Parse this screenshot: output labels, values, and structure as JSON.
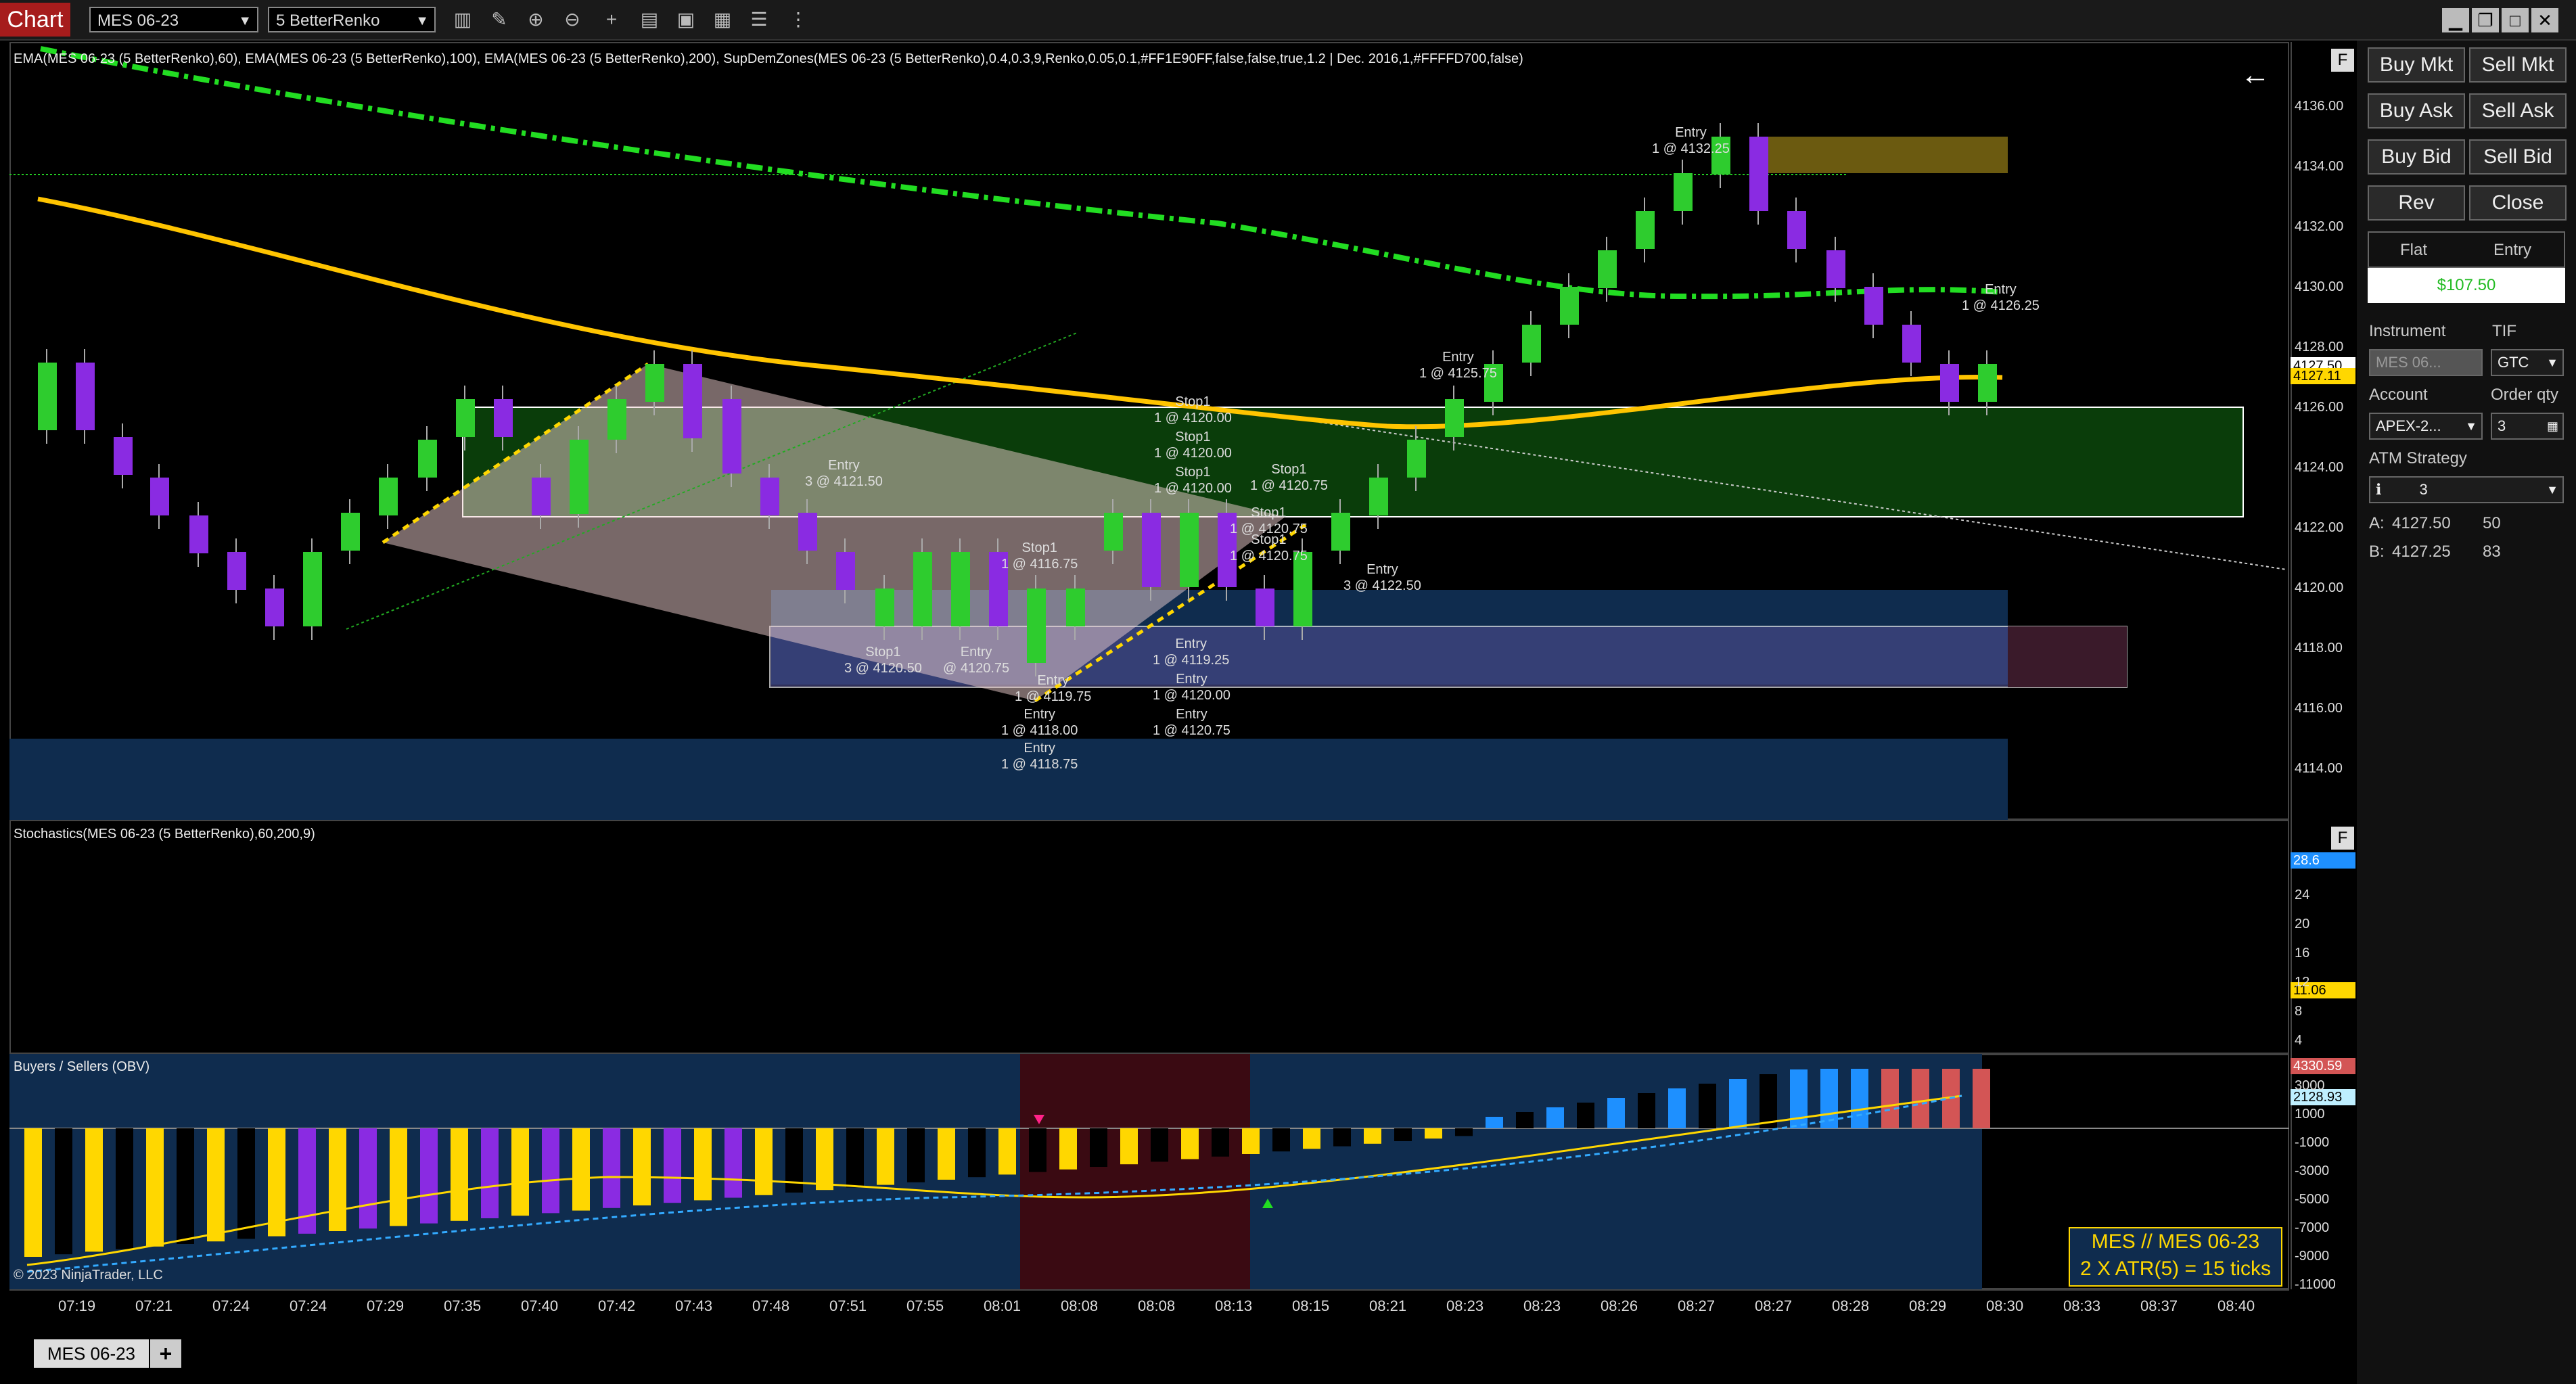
{
  "toolbar": {
    "chart_tab": "Chart",
    "instrument": "MES 06-23",
    "bar_type": "5 BetterRenko",
    "icons": [
      "bars-icon",
      "pencil-icon",
      "zoom-in-icon",
      "zoom-out-icon",
      "crosshair-icon",
      "properties-icon",
      "strategy-icon",
      "indicator-icon",
      "list-icon"
    ]
  },
  "main_panel": {
    "indicator_label": "EMA(MES 06-23 (5 BetterRenko),60), EMA(MES 06-23 (5 BetterRenko),100), EMA(MES 06-23 (5 BetterRenko),200), SupDemZones(MES 06-23 (5 BetterRenko),0.4,0.3,9,Renko,0.05,0.1,#FF1E90FF,false,false,true,1.2 | Dec. 2016,1,#FFFFD700,false)",
    "price_ticks": [
      "4136.00",
      "4134.00",
      "4132.00",
      "4130.00",
      "4128.00",
      "4126.00",
      "4124.00",
      "4122.00",
      "4120.00",
      "4118.00",
      "4116.00",
      "4114.00"
    ],
    "ask_tag": "4127.50",
    "last_tag": "4127.11",
    "annotations": [
      {
        "line1": "Entry",
        "line2": "1 @ 4132.25"
      },
      {
        "line1": "Entry",
        "line2": "1 @ 4126.25"
      },
      {
        "line1": "Entry",
        "line2": "1 @ 4125.75"
      },
      {
        "line1": "Stop1",
        "line2": "1 @ 4120.00"
      },
      {
        "line1": "Stop1",
        "line2": "1 @ 4120.00"
      },
      {
        "line1": "Stop1",
        "line2": "1 @ 4120.00"
      },
      {
        "line1": "Stop1",
        "line2": "1 @ 4120.75"
      },
      {
        "line1": "Stop1",
        "line2": "1 @ 4120.75"
      },
      {
        "line1": "Stop1",
        "line2": "1 @ 4120.75"
      },
      {
        "line1": "Entry",
        "line2": "3 @ 4121.50"
      },
      {
        "line1": "Stop1",
        "line2": "1 @ 4116.75"
      },
      {
        "line1": "Entry",
        "line2": "3 @ 4122.50"
      },
      {
        "line1": "Stop1",
        "line2": "3 @ 4120.50"
      },
      {
        "line1": "Entry",
        "line2": "@ 4120.75"
      },
      {
        "line1": "Entry",
        "line2": "1 @ 4119.25"
      },
      {
        "line1": "Entry",
        "line2": "1 @ 4119.75"
      },
      {
        "line1": "Entry",
        "line2": "1 @ 4120.00"
      },
      {
        "line1": "Entry",
        "line2": "1 @ 4118.00"
      },
      {
        "line1": "Entry",
        "line2": "1 @ 4120.75"
      },
      {
        "line1": "Entry",
        "line2": "1 @ 4118.75"
      }
    ]
  },
  "stoch_panel": {
    "label": "Stochastics(MES 06-23 (5 BetterRenko),60,200,9)",
    "ticks": [
      "24",
      "20",
      "16",
      "12",
      "8",
      "4"
    ],
    "tag_top": "28.6",
    "tag_mid": "11.06"
  },
  "obv_panel": {
    "label": "Buyers /  Sellers (OBV)",
    "ticks": [
      "3000",
      "1000",
      "-1000",
      "-3000",
      "-5000",
      "-7000",
      "-9000",
      "-11000"
    ],
    "tag_top": "4330.59",
    "tag_mid": "2128.93",
    "copyright": "© 2023 NinjaTrader, LLC",
    "info_line1": "MES // MES 06-23",
    "info_line2": "2 X ATR(5) = 15 ticks"
  },
  "time_axis": [
    "07:19",
    "07:21",
    "07:24",
    "07:24",
    "07:29",
    "07:35",
    "07:40",
    "07:42",
    "07:43",
    "07:48",
    "07:51",
    "07:55",
    "08:01",
    "08:08",
    "08:08",
    "08:13",
    "08:15",
    "08:21",
    "08:23",
    "08:23",
    "08:26",
    "08:27",
    "08:27",
    "08:28",
    "08:29",
    "08:30",
    "08:33",
    "08:37",
    "08:40"
  ],
  "trade_panel": {
    "buy_mkt": "Buy Mkt",
    "sell_mkt": "Sell Mkt",
    "buy_ask": "Buy Ask",
    "sell_ask": "Sell Ask",
    "buy_bid": "Buy Bid",
    "sell_bid": "Sell Bid",
    "rev": "Rev",
    "close": "Close",
    "position": "Flat",
    "entry": "Entry",
    "pnl": "$107.50",
    "instrument_label": "Instrument",
    "tif_label": "TIF",
    "instrument_value": "MES 06...",
    "tif_value": "GTC",
    "account_label": "Account",
    "order_qty_label": "Order qty",
    "account_value": "APEX-2...",
    "order_qty_value": "3",
    "atm_label": "ATM Strategy",
    "atm_value": "3",
    "ask_label": "A:",
    "ask_price": "4127.50",
    "ask_size": "50",
    "bid_label": "B:",
    "bid_price": "4127.25",
    "bid_size": "83"
  },
  "bottom_tab": "MES 06-23",
  "colors": {
    "up": "#2ecc2e",
    "down": "#8a2be2",
    "ema_fast": "#ffc400",
    "ema_slow": "#22dd22",
    "supply": "#6b5a10",
    "demand_green": "#0a3d0a",
    "demand_blue": "#0f2c4e",
    "obv_yellow": "#ffd700",
    "obv_purple": "#8a2be2",
    "obv_blue": "#1e90ff",
    "obv_red": "#d35555"
  }
}
